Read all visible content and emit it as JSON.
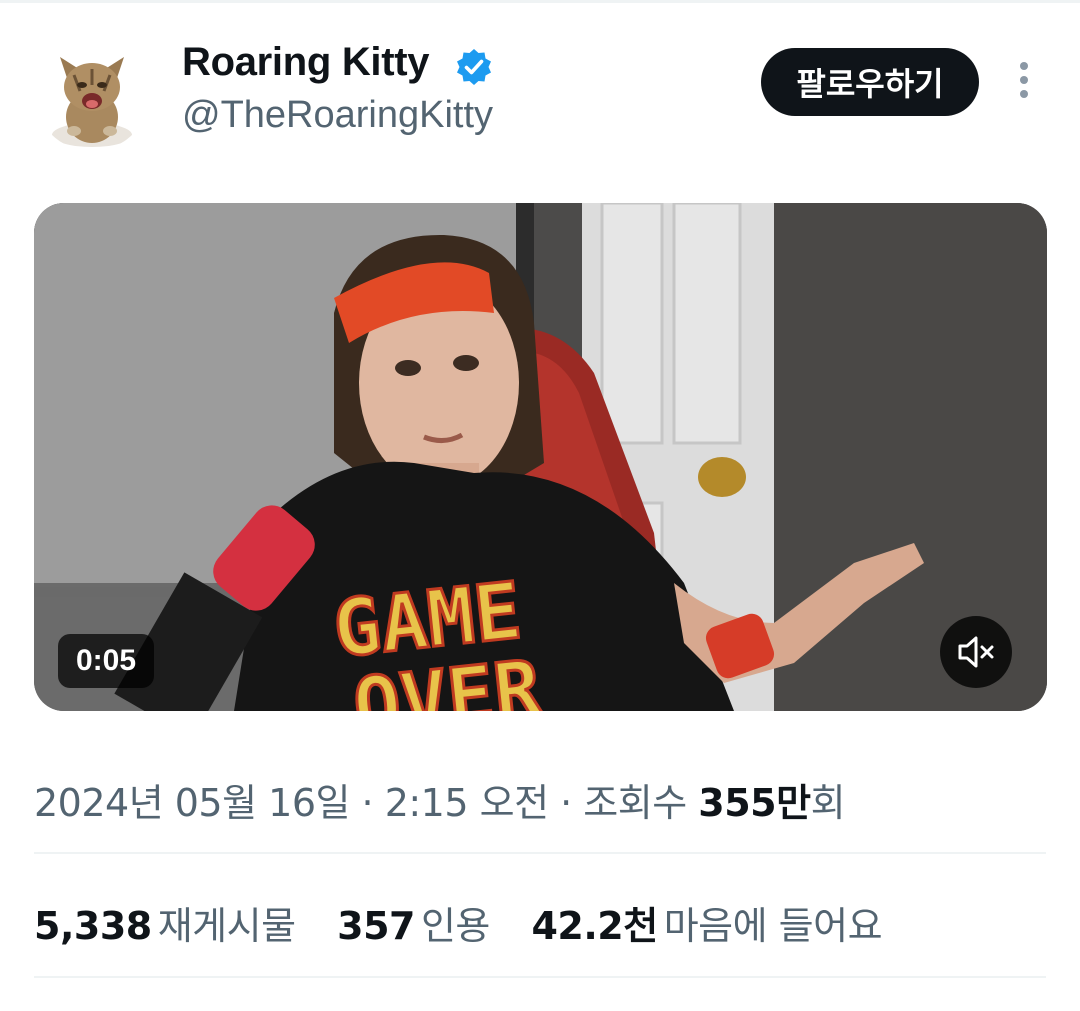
{
  "profile": {
    "name": "Roaring Kitty",
    "handle": "@TheRoaringKitty",
    "verified_icon": "verified-badge-icon",
    "avatar_icon": "kitten-avatar"
  },
  "actions": {
    "follow_label": "팔로우하기",
    "more_icon": "more-vertical-icon"
  },
  "video": {
    "elapsed": "0:05",
    "mute_icon": "speaker-muted-icon",
    "shirt_text": [
      "GAME",
      "OVER"
    ]
  },
  "meta": {
    "date": "2024년 05월 16일",
    "sep1": " · ",
    "time": "2:15 오전",
    "sep2": " · ",
    "views_label": "조회수 ",
    "views_value": "355만",
    "views_suffix": "회"
  },
  "stats": {
    "reposts": {
      "value": "5,338",
      "label": "재게시물"
    },
    "quotes": {
      "value": "357",
      "label": "인용"
    },
    "likes": {
      "value": "42.2천",
      "label": "마음에 들어요"
    }
  },
  "colors": {
    "text": "#0f1419",
    "secondary": "#536471",
    "verified": "#1d9bf0",
    "follow_bg": "#0f1419"
  }
}
